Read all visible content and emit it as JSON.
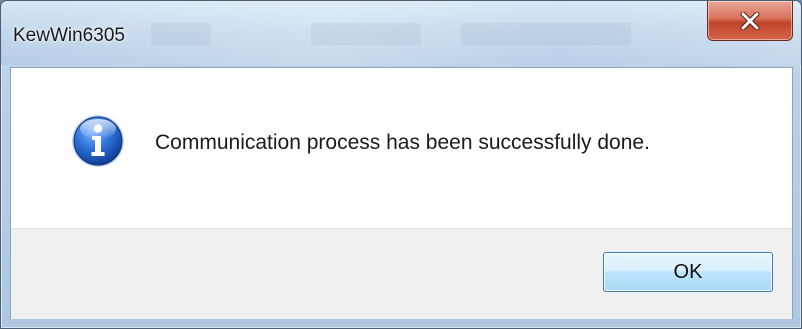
{
  "window": {
    "title": "KewWin6305"
  },
  "dialog": {
    "icon": "information-icon",
    "message": "Communication process has been successfully done.",
    "ok_label": "OK"
  },
  "colors": {
    "close_button": "#c9503a",
    "ok_button_border": "#3c7fb1",
    "info_icon_blue": "#1f5fbf"
  }
}
